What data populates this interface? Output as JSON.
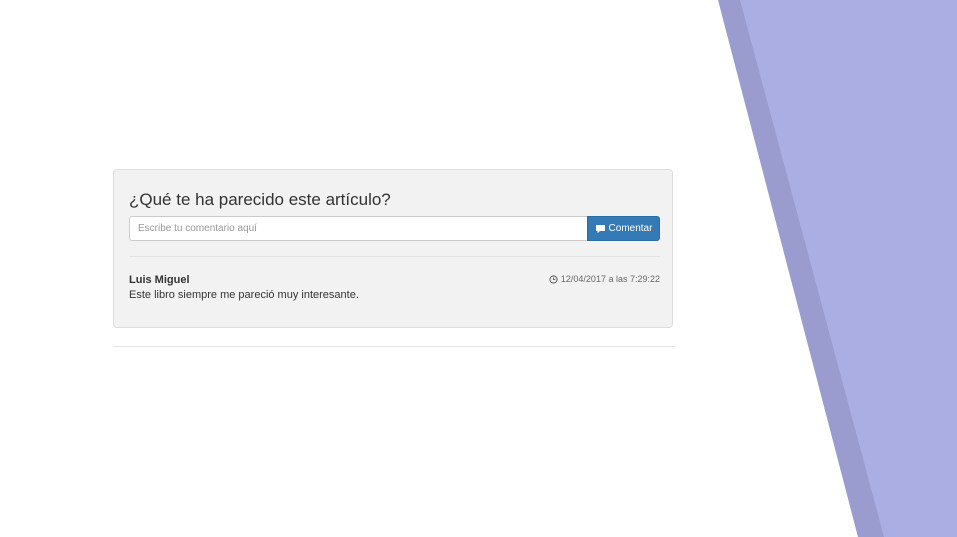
{
  "comments_section": {
    "title": "¿Qué te ha parecido este artículo?",
    "input_placeholder": "Escribe tu comentario aquí",
    "input_value": "",
    "submit_label": "Comentar",
    "submit_icon": "comment-icon"
  },
  "comments": [
    {
      "author": "Luis Miguel",
      "text": "Este libro siempre me pareció muy interesante.",
      "date": "12/04/2017 a las 7:29:22",
      "date_icon": "clock-icon"
    }
  ],
  "colors": {
    "primary_button": "#337ab7",
    "panel_background": "#f2f2f2",
    "decor_purple_light": "#aaaee3",
    "decor_purple_dark": "#9a9bcf"
  }
}
